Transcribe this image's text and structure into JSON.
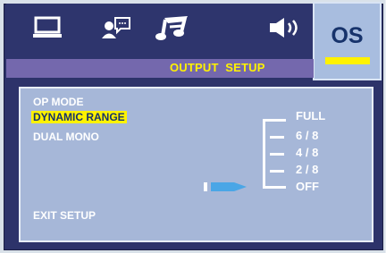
{
  "header": {
    "icons": [
      "monitor-icon",
      "speaker-chat-icon",
      "music-note-icon",
      "audio-speaker-icon"
    ],
    "active_tab": "OS",
    "title": "OUTPUT  SETUP"
  },
  "menu": {
    "items": [
      "OP MODE",
      "DYNAMIC RANGE",
      "DUAL MONO"
    ],
    "selected_index": 1,
    "exit_label": "EXIT SETUP"
  },
  "dynamic_range": {
    "levels": [
      "FULL",
      "6 / 8",
      "4 / 8",
      "2 / 8",
      "OFF"
    ],
    "current": "OFF"
  },
  "colors": {
    "frame": "#2d336a",
    "panel": "#a6b7d8",
    "title_band": "#7468ad",
    "accent_yellow": "#fff200",
    "tab_active": "#a8bddf"
  }
}
